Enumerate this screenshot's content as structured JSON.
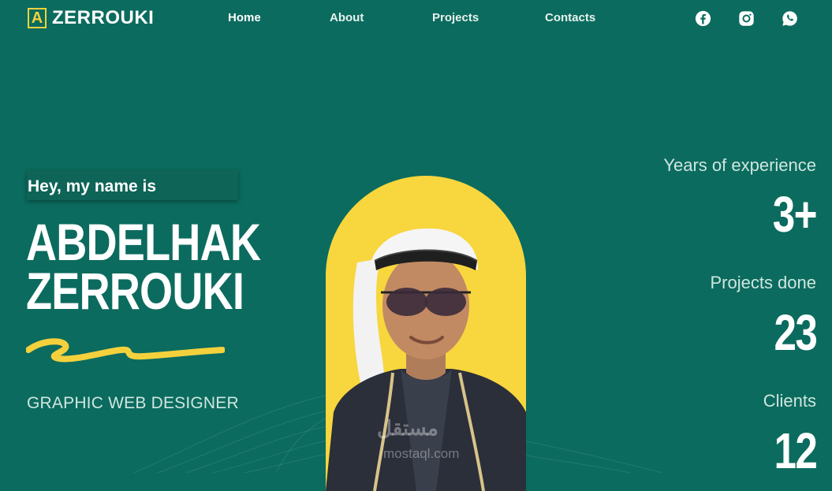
{
  "header": {
    "logo_mark": "A",
    "logo_text": "ZERROUKI",
    "nav": [
      {
        "label": "Home"
      },
      {
        "label": "About"
      },
      {
        "label": "Projects"
      },
      {
        "label": "Contacts"
      }
    ],
    "social_icons": [
      "facebook-icon",
      "instagram-icon",
      "whatsapp-icon"
    ]
  },
  "hero": {
    "greeting": "Hey, my name is",
    "first_name": "ABDELHAK",
    "last_name": "ZERROUKI",
    "role": "GRAPHIC WEB DESIGNER"
  },
  "stats": [
    {
      "label": "Years of experience",
      "value": "3+"
    },
    {
      "label": "Projects done",
      "value": "23"
    },
    {
      "label": "Clients",
      "value": "12"
    }
  ],
  "watermark": {
    "arabic": "مستقل",
    "latin": "mostaql.com"
  },
  "colors": {
    "background": "#0b6b5e",
    "accent": "#f4d13c",
    "photo_bg": "#f7d63e",
    "muted_text": "#cfe6e0"
  }
}
